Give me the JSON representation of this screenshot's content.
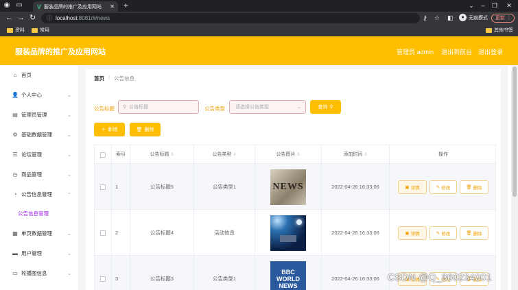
{
  "browser": {
    "tab_title": "服装品牌的推广及应用网站",
    "url_host": "localhost",
    "url_path": ":8081/#/news",
    "incognito_label": "无痕模式",
    "update_label": "更新",
    "bookmarks": [
      "资料",
      "常用"
    ],
    "other_bookmarks": "其他书签"
  },
  "header": {
    "title": "服装品牌的推广及应用网站",
    "links": [
      "管理员 admin",
      "退出到前台",
      "退出登录"
    ]
  },
  "sidebar": {
    "items": [
      {
        "label": "首页",
        "icon": "home-icon",
        "has_children": false
      },
      {
        "label": "个人中心",
        "icon": "user-icon",
        "has_children": true
      },
      {
        "label": "管理员管理",
        "icon": "admin-icon",
        "has_children": true
      },
      {
        "label": "基础数据管理",
        "icon": "data-icon",
        "has_children": true
      },
      {
        "label": "论坛管理",
        "icon": "forum-icon",
        "has_children": true
      },
      {
        "label": "商品管理",
        "icon": "goods-icon",
        "has_children": true
      },
      {
        "label": "公告信息管理",
        "icon": "notice-icon",
        "has_children": true,
        "expanded": true
      },
      {
        "label": "单页数据管理",
        "icon": "page-icon",
        "has_children": true
      },
      {
        "label": "用户管理",
        "icon": "users-icon",
        "has_children": true
      },
      {
        "label": "轮播图信息",
        "icon": "carousel-icon",
        "has_children": true
      }
    ],
    "sub_item": "公告信息管理"
  },
  "breadcrumb": {
    "home": "首页",
    "sep": "/",
    "current": "公告信息"
  },
  "search": {
    "title_label": "公告标题",
    "title_placeholder": "公告标题",
    "type_label": "公告类型",
    "type_placeholder": "请选择公告类型",
    "query_button": "查询"
  },
  "actions": {
    "add": "新增",
    "delete": "删除"
  },
  "table": {
    "headers": [
      "索引",
      "公告标题",
      "公告类型",
      "公告图片",
      "添加时间",
      "操作"
    ],
    "row_actions": {
      "detail": "详情",
      "edit": "修改",
      "delete": "删除"
    },
    "rows": [
      {
        "index": "1",
        "title": "公告标题5",
        "type": "公告类型1",
        "image_text": "NEWS",
        "time": "2022-04-26 16:33:06"
      },
      {
        "index": "2",
        "title": "公告标题4",
        "type": "活动信息",
        "image_text": "",
        "time": "2022-04-26 16:33:06"
      },
      {
        "index": "3",
        "title": "公告标题3",
        "type": "公告类型1",
        "image_text": "BBC WORLD NEWS",
        "time": "2022-04-26 16:33:06"
      }
    ]
  },
  "watermark": "CSDN @Q_860234001",
  "colors": {
    "brand": "#ffbf00",
    "accent_text": "#f0a000",
    "sub_active": "#a020f0"
  }
}
